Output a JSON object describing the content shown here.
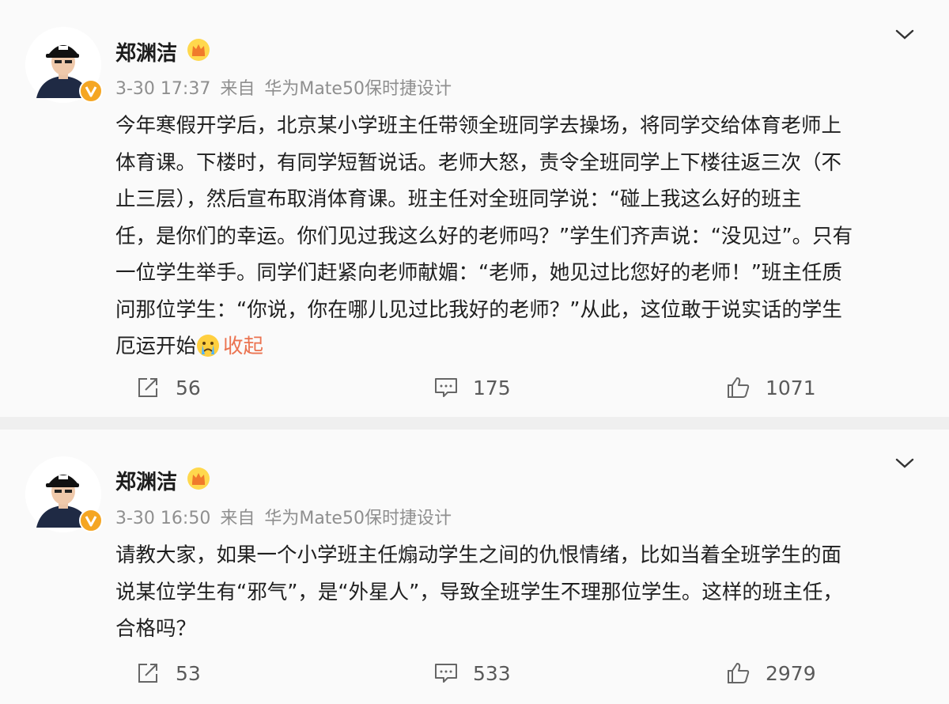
{
  "posts": [
    {
      "username": "郑渊洁",
      "time": "3-30 17:37",
      "source_prefix": "来自",
      "source": "华为Mate50保时捷设计",
      "lines": [
        "今年寒假开学后，北京某小学班主任带领全班同学去操场，将同学交给体育老师上",
        "体育课。下楼时，有同学短暂说话。老师大怒，责令全班同学上下楼往返三次（不",
        "止三层），然后宣布取消体育课。班主任对全班同学说：“碰上我这么好的班主",
        "任，是你们的幸运。你们见过我这么好的老师吗？”学生们齐声说：“没见过”。只有",
        "一位学生举手。同学们赶紧向老师献媚：“老师，她见过比您好的老师！”班主任质",
        "问那位学生：“你说，你在哪儿见过比我好的老师？”从此，这位敢于说实话的学生",
        "厄运开始"
      ],
      "collapse_label": "收起",
      "reposts": "56",
      "comments": "175",
      "likes": "1071"
    },
    {
      "username": "郑渊洁",
      "time": "3-30 16:50",
      "source_prefix": "来自",
      "source": "华为Mate50保时捷设计",
      "lines": [
        "请教大家，如果一个小学班主任煽动学生之间的仇恨情绪，比如当着全班学生的面",
        "说某位学生有“邪气”，是“外星人”，导致全班学生不理那位学生。这样的班主任，",
        "合格吗？"
      ],
      "reposts": "53",
      "comments": "533",
      "likes": "2979"
    }
  ],
  "icons": {
    "verified_badge": "v-badge-icon",
    "vip": "crown-icon",
    "menu": "chevron-down-icon",
    "repost": "repost-icon",
    "comment": "comment-icon",
    "like": "thumbs-up-icon",
    "emoji": "crying-emoji-icon"
  },
  "colors": {
    "link": "#eb7350",
    "badge": "#f5a623",
    "meta": "#8f8f8f"
  }
}
